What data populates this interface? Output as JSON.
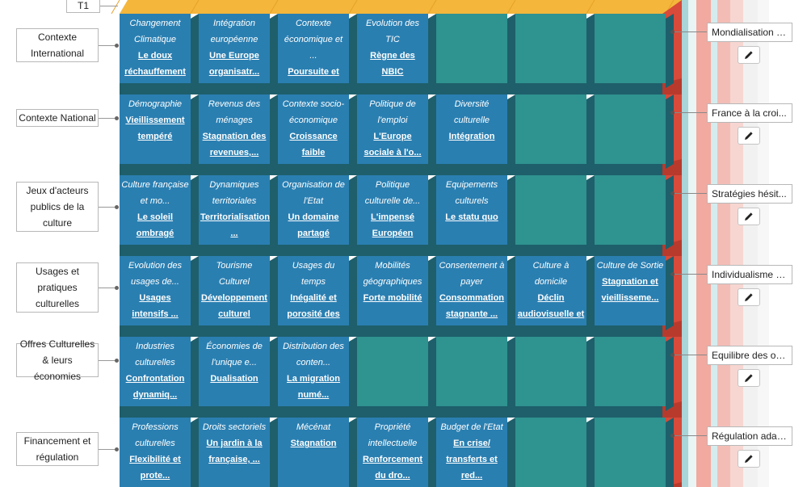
{
  "header": {
    "t1_label": "T1"
  },
  "colors": {
    "filled_cell": "#2a7fb1",
    "empty_cell": "#2f9390",
    "top_face": "#f4b63b",
    "side_face": "#d84a3a",
    "dark_band": "#1e5f6b"
  },
  "rows": [
    {
      "label": "Contexte International",
      "right_label": "Mondialisation s...",
      "cells": [
        {
          "sub": "Changement Climatique",
          "val": "Le doux réchauffement"
        },
        {
          "sub": "Intégration européenne",
          "val": "Une Europe organisatr..."
        },
        {
          "sub": "Contexte économique et ...",
          "val": "Poursuite et appr..."
        },
        {
          "sub": "Evolution des TIC",
          "val": "Règne des NBIC"
        },
        {},
        {},
        {}
      ]
    },
    {
      "label": "Contexte National",
      "right_label": "France à la croi...",
      "cells": [
        {
          "sub": "Démographie",
          "val": "Vieillissement tempéré"
        },
        {
          "sub": "Revenus des ménages",
          "val": "Stagnation des revenues,..."
        },
        {
          "sub": "Contexte socio-économique",
          "val": "Croissance faible"
        },
        {
          "sub": "Politique de l'emploi",
          "val": "L'Europe sociale à l'o..."
        },
        {
          "sub": "Diversité culturelle",
          "val": "Intégration"
        },
        {},
        {}
      ]
    },
    {
      "label": "Jeux d'acteurs publics de la culture",
      "right_label": "Stratégies hésit...",
      "cells": [
        {
          "sub": "Culture française et mo...",
          "val": "Le soleil ombragé"
        },
        {
          "sub": "Dynamiques territoriales",
          "val": "Territorialisation ..."
        },
        {
          "sub": "Organisation de l'Etat",
          "val": "Un domaine partagé"
        },
        {
          "sub": "Politique culturelle de...",
          "val": "L'impensé Européen"
        },
        {
          "sub": "Equipements culturels",
          "val": "Le statu quo"
        },
        {},
        {}
      ]
    },
    {
      "label": "Usages et pratiques culturelles",
      "right_label": "Individualisme c...",
      "cells": [
        {
          "sub": "Evolution des usages de...",
          "val": "Usages intensifs ..."
        },
        {
          "sub": "Tourisme Culturel",
          "val": "Développement culturel"
        },
        {
          "sub": "Usages du temps",
          "val": "Inégalité et porosité des te..."
        },
        {
          "sub": "Mobilités géographiques",
          "val": "Forte mobilité"
        },
        {
          "sub": "Consentement à payer",
          "val": "Consommation stagnante ..."
        },
        {
          "sub": "Culture à domicile",
          "val": "Déclin audiovisuelle et d..."
        },
        {
          "sub": "Culture de Sortie",
          "val": "Stagnation et vieillisseme..."
        }
      ]
    },
    {
      "label": "Offres Culturelles & leurs économies",
      "right_label": "Equilibre des off...",
      "cells": [
        {
          "sub": "Industries culturelles",
          "val": "Confrontation dynamiq..."
        },
        {
          "sub": "Économies de l'unique e...",
          "val": "Dualisation"
        },
        {
          "sub": "Distribution des conten...",
          "val": "La migration numé..."
        },
        {},
        {},
        {},
        {}
      ]
    },
    {
      "label": "Financement et régulation",
      "right_label": "Régulation adap...",
      "cells": [
        {
          "sub": "Professions culturelles",
          "val": "Flexibilité et prote..."
        },
        {
          "sub": "Droits sectoriels",
          "val": "Un jardin à la française, ..."
        },
        {
          "sub": "Mécénat",
          "val": "Stagnation"
        },
        {
          "sub": "Propriété intellectuelle",
          "val": "Renforcement du dro..."
        },
        {
          "sub": "Budget de l'Etat",
          "val": "En crise/ transferts et red..."
        },
        {},
        {}
      ]
    }
  ]
}
